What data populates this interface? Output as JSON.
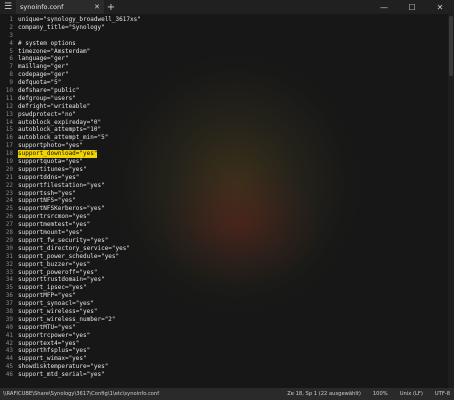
{
  "window": {
    "tab_title": "synoinfo.conf",
    "menu_icon": "hamburger-icon",
    "new_tab_icon": "plus-icon",
    "close_tab_icon": "close-icon"
  },
  "editor": {
    "highlight_color": "#f2d400",
    "highlighted_line": 18,
    "lines": [
      {
        "n": "1",
        "text": "unique=\"synology_broadwell_3617xs\""
      },
      {
        "n": "2",
        "text": "company_title=\"Synology\""
      },
      {
        "n": "3",
        "text": ""
      },
      {
        "n": "4",
        "text": "# system options"
      },
      {
        "n": "5",
        "text": "timezone=\"Amsterdam\""
      },
      {
        "n": "6",
        "text": "language=\"ger\""
      },
      {
        "n": "7",
        "text": "maillang=\"ger\""
      },
      {
        "n": "8",
        "text": "codepage=\"ger\""
      },
      {
        "n": "9",
        "text": "defquota=\"5\""
      },
      {
        "n": "10",
        "text": "defshare=\"public\""
      },
      {
        "n": "11",
        "text": "defgroup=\"users\""
      },
      {
        "n": "12",
        "text": "defright=\"writeable\""
      },
      {
        "n": "13",
        "text": "pswdprotect=\"no\""
      },
      {
        "n": "14",
        "text": "autoblock_expireday=\"0\""
      },
      {
        "n": "15",
        "text": "autoblock_attempts=\"10\""
      },
      {
        "n": "16",
        "text": "autoblock_attempt_min=\"5\""
      },
      {
        "n": "17",
        "text": "supportphoto=\"yes\""
      },
      {
        "n": "18",
        "text": "support_download=\"yes\""
      },
      {
        "n": "19",
        "text": "supportquota=\"yes\""
      },
      {
        "n": "20",
        "text": "supportitunes=\"yes\""
      },
      {
        "n": "21",
        "text": "supportddns=\"yes\""
      },
      {
        "n": "22",
        "text": "supportfilestation=\"yes\""
      },
      {
        "n": "23",
        "text": "supportssh=\"yes\""
      },
      {
        "n": "24",
        "text": "supportNFS=\"yes\""
      },
      {
        "n": "25",
        "text": "supportNFSKerberos=\"yes\""
      },
      {
        "n": "26",
        "text": "supportrsrcmon=\"yes\""
      },
      {
        "n": "27",
        "text": "supportmemtest=\"yes\""
      },
      {
        "n": "28",
        "text": "supportmount=\"yes\""
      },
      {
        "n": "29",
        "text": "support_fw_security=\"yes\""
      },
      {
        "n": "30",
        "text": "support_directory_service=\"yes\""
      },
      {
        "n": "31",
        "text": "support_power_schedule=\"yes\""
      },
      {
        "n": "32",
        "text": "support_buzzer=\"yes\""
      },
      {
        "n": "33",
        "text": "support_poweroff=\"yes\""
      },
      {
        "n": "34",
        "text": "supporttrustdomain=\"yes\""
      },
      {
        "n": "35",
        "text": "support_ipsec=\"yes\""
      },
      {
        "n": "36",
        "text": "supportMFP=\"yes\""
      },
      {
        "n": "37",
        "text": "support_synoacl=\"yes\""
      },
      {
        "n": "38",
        "text": "support_wireless=\"yes\""
      },
      {
        "n": "39",
        "text": "support_wireless_number=\"2\""
      },
      {
        "n": "40",
        "text": "supportMTU=\"yes\""
      },
      {
        "n": "41",
        "text": "supportrcpower=\"yes\""
      },
      {
        "n": "42",
        "text": "supportext4=\"yes\""
      },
      {
        "n": "43",
        "text": "supporthfsplus=\"yes\""
      },
      {
        "n": "44",
        "text": "support_wimax=\"yes\""
      },
      {
        "n": "45",
        "text": "showdisktemperature=\"yes\""
      },
      {
        "n": "46",
        "text": "support_mtd_serial=\"yes\""
      }
    ]
  },
  "statusbar": {
    "path": "\\\\RAFICUBE\\Share\\Synology\\3617\\Config\\1\\etc\\synoinfo.conf",
    "position": "Ze 18, Sp 1 (22 ausgewählt)",
    "zoom": "100%",
    "line_ending": "Unix (LF)",
    "encoding": "UTF-8"
  }
}
